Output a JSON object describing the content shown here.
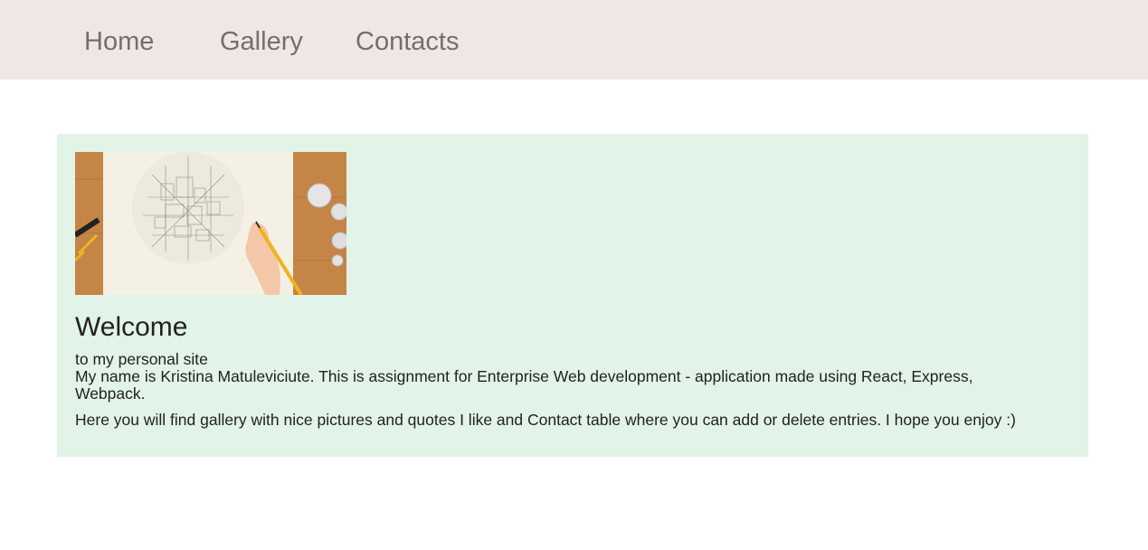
{
  "nav": {
    "items": [
      {
        "label": "Home"
      },
      {
        "label": "Gallery"
      },
      {
        "label": "Contacts"
      }
    ]
  },
  "main": {
    "hero_image": {
      "icon": "drawing-hand-pencil-image"
    },
    "heading": "Welcome",
    "subheading": "to my personal site",
    "intro": "My name is Kristina Matuleviciute. This is assignment for Enterprise Web development - application made using React, Express, Webpack.",
    "description": "Here you will find gallery with nice pictures and quotes I like and Contact table where you can add or delete entries. I hope you enjoy :)"
  },
  "colors": {
    "navbar_bg": "#f0e6e4",
    "nav_text": "#707070",
    "panel_bg": "#e2f3e8",
    "body_text": "#222222"
  }
}
